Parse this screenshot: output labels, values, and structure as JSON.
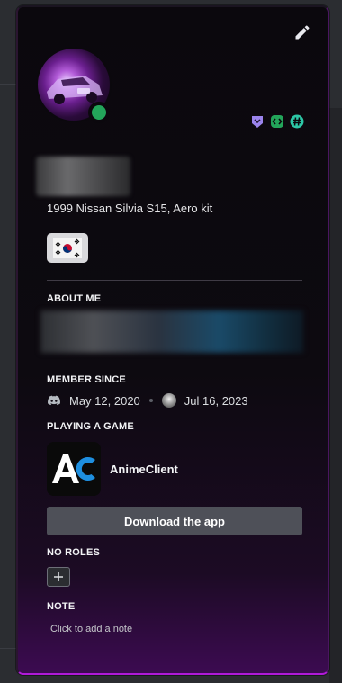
{
  "profile": {
    "custom_status": "1999 Nissan Silvia S15, Aero kit",
    "status": "online",
    "edit_icon": "pencil-icon",
    "badges": [
      "hypesquad-icon",
      "active-developer-icon",
      "hashtag-icon"
    ]
  },
  "sections": {
    "about_me": "ABOUT ME",
    "member_since": "MEMBER SINCE",
    "playing": "PLAYING A GAME",
    "roles": "NO ROLES",
    "note": "NOTE"
  },
  "member_since": {
    "discord_date": "May 12, 2020",
    "server_date": "Jul 16, 2023"
  },
  "game": {
    "name": "AnimeClient",
    "button": "Download the app"
  },
  "note": {
    "placeholder": "Click to add a note"
  },
  "colors": {
    "online": "#23a55a",
    "accent_border": "#b01ad8",
    "button": "#4e5058"
  }
}
